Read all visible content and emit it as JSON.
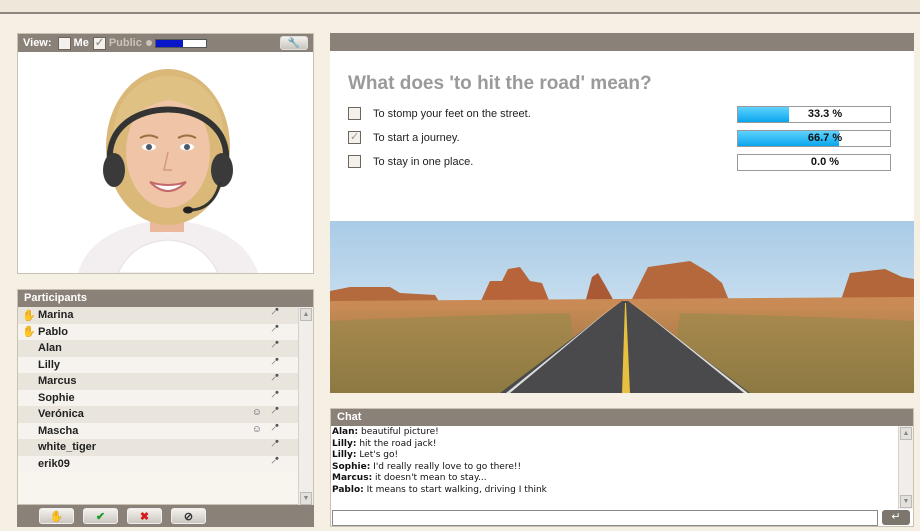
{
  "view_bar": {
    "view_label": "View:",
    "me_label": "Me",
    "me_checked": false,
    "public_label": "Public",
    "public_checked": true,
    "volume_level": 0.55,
    "settings_icon": "wrench-icon"
  },
  "participants": {
    "title": "Participants",
    "items": [
      {
        "name": "Marina",
        "hand_raised": true,
        "has_user_icon": false
      },
      {
        "name": "Pablo",
        "hand_raised": true,
        "has_user_icon": false
      },
      {
        "name": "Alan",
        "hand_raised": false,
        "has_user_icon": false
      },
      {
        "name": "Lilly",
        "hand_raised": false,
        "has_user_icon": false
      },
      {
        "name": "Marcus",
        "hand_raised": false,
        "has_user_icon": false
      },
      {
        "name": "Sophie",
        "hand_raised": false,
        "has_user_icon": false
      },
      {
        "name": "Verónica",
        "hand_raised": false,
        "has_user_icon": true
      },
      {
        "name": "Mascha",
        "hand_raised": false,
        "has_user_icon": true
      },
      {
        "name": "white_tiger",
        "hand_raised": false,
        "has_user_icon": false
      },
      {
        "name": "erik09",
        "hand_raised": false,
        "has_user_icon": false
      }
    ]
  },
  "action_buttons": [
    {
      "icon": "raise-hand-icon",
      "glyph": "✋",
      "color": "#555555"
    },
    {
      "icon": "check-icon",
      "glyph": "✔",
      "color": "#1e9a2a"
    },
    {
      "icon": "cross-icon",
      "glyph": "✖",
      "color": "#d41c1c"
    },
    {
      "icon": "block-icon",
      "glyph": "⊘",
      "color": "#333333"
    }
  ],
  "quiz": {
    "question": "What does 'to hit the road' mean?",
    "options": [
      {
        "text": "To stomp your feet on the street.",
        "checked": false,
        "percent": 33.3,
        "percent_label": "33.3 %"
      },
      {
        "text": "To start a journey.",
        "checked": true,
        "percent": 66.7,
        "percent_label": "66.7 %"
      },
      {
        "text": "To stay in one place.",
        "checked": false,
        "percent": 0.0,
        "percent_label": "0.0 %"
      }
    ]
  },
  "chat": {
    "title": "Chat",
    "messages": [
      {
        "user": "Alan:",
        "text": " beautiful picture!"
      },
      {
        "user": "Lilly:",
        "text": " hit the road jack!"
      },
      {
        "user": "Lilly:",
        "text": " Let's go!"
      },
      {
        "user": "Sophie:",
        "text": " I'd really really love to go there!!"
      },
      {
        "user": "Marcus:",
        "text": " it doesn't mean to stay..."
      },
      {
        "user": "Pablo:",
        "text": " It means to start walking, driving I think"
      }
    ],
    "input_value": "",
    "send_icon": "enter-icon"
  },
  "colors": {
    "panel_header": "#8a8278",
    "progress_fill": "#0aa6ec",
    "volume_fill": "#0818c8",
    "background": "#f6efe3"
  }
}
